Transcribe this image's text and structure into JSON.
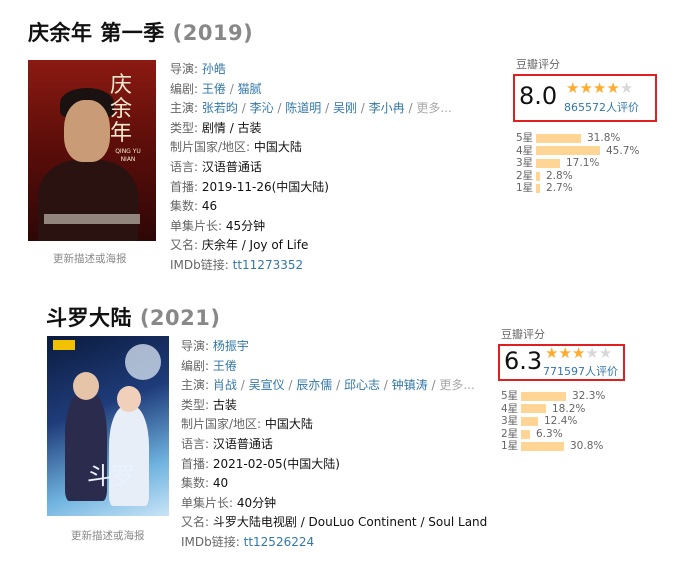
{
  "entries": [
    {
      "title": "庆余年 第一季",
      "year": "(2019)",
      "poster_caption": "更新描述或海报",
      "poster_text": "庆余年",
      "poster_subtext": "QING YU NIAN",
      "info": {
        "director_label": "导演:",
        "director": "孙皓",
        "writer_label": "编剧:",
        "writers": [
          "王倦",
          "猫腻"
        ],
        "cast_label": "主演:",
        "cast": [
          "张若昀",
          "李沁",
          "陈道明",
          "吴刚",
          "李小冉"
        ],
        "more": "更多...",
        "genre_label": "类型:",
        "genre": "剧情 / 古装",
        "country_label": "制片国家/地区:",
        "country": "中国大陆",
        "language_label": "语言:",
        "language": "汉语普通话",
        "premiere_label": "首播:",
        "premiere": "2019-11-26(中国大陆)",
        "episodes_label": "集数:",
        "episodes": "46",
        "runtime_label": "单集片长:",
        "runtime": "45分钟",
        "aka_label": "又名:",
        "aka": "庆余年 / Joy of Life",
        "imdb_label": "IMDb链接:",
        "imdb": "tt11273352"
      },
      "rating": {
        "label": "豆瓣评分",
        "score": "8.0",
        "stars_filled": 4,
        "stars_total": 5,
        "votes": "865572人评价",
        "breakdown": [
          {
            "star": "5星",
            "pct": "31.8%",
            "value": 31.8
          },
          {
            "star": "4星",
            "pct": "45.7%",
            "value": 45.7
          },
          {
            "star": "3星",
            "pct": "17.1%",
            "value": 17.1
          },
          {
            "star": "2星",
            "pct": "2.8%",
            "value": 2.8
          },
          {
            "star": "1星",
            "pct": "2.7%",
            "value": 2.7
          }
        ]
      }
    },
    {
      "title": "斗罗大陆",
      "year": "(2021)",
      "poster_caption": "更新描述或海报",
      "poster_text": "斗罗",
      "info": {
        "director_label": "导演:",
        "director": "杨振宇",
        "writer_label": "编剧:",
        "writers": [
          "王倦"
        ],
        "cast_label": "主演:",
        "cast": [
          "肖战",
          "吴宣仪",
          "辰亦儒",
          "邱心志",
          "钟镇涛"
        ],
        "more": "更多...",
        "genre_label": "类型:",
        "genre": "古装",
        "country_label": "制片国家/地区:",
        "country": "中国大陆",
        "language_label": "语言:",
        "language": "汉语普通话",
        "premiere_label": "首播:",
        "premiere": "2021-02-05(中国大陆)",
        "episodes_label": "集数:",
        "episodes": "40",
        "runtime_label": "单集片长:",
        "runtime": "40分钟",
        "aka_label": "又名:",
        "aka": "斗罗大陆电视剧 / DouLuo Continent / Soul Land",
        "imdb_label": "IMDb链接:",
        "imdb": "tt12526224"
      },
      "rating": {
        "label": "豆瓣评分",
        "score": "6.3",
        "stars_filled": 3,
        "stars_total": 5,
        "votes": "771597人评价",
        "breakdown": [
          {
            "star": "5星",
            "pct": "32.3%",
            "value": 32.3
          },
          {
            "star": "4星",
            "pct": "18.2%",
            "value": 18.2
          },
          {
            "star": "3星",
            "pct": "12.4%",
            "value": 12.4
          },
          {
            "star": "2星",
            "pct": "6.3%",
            "value": 6.3
          },
          {
            "star": "1星",
            "pct": "30.8%",
            "value": 30.8
          }
        ]
      }
    }
  ]
}
